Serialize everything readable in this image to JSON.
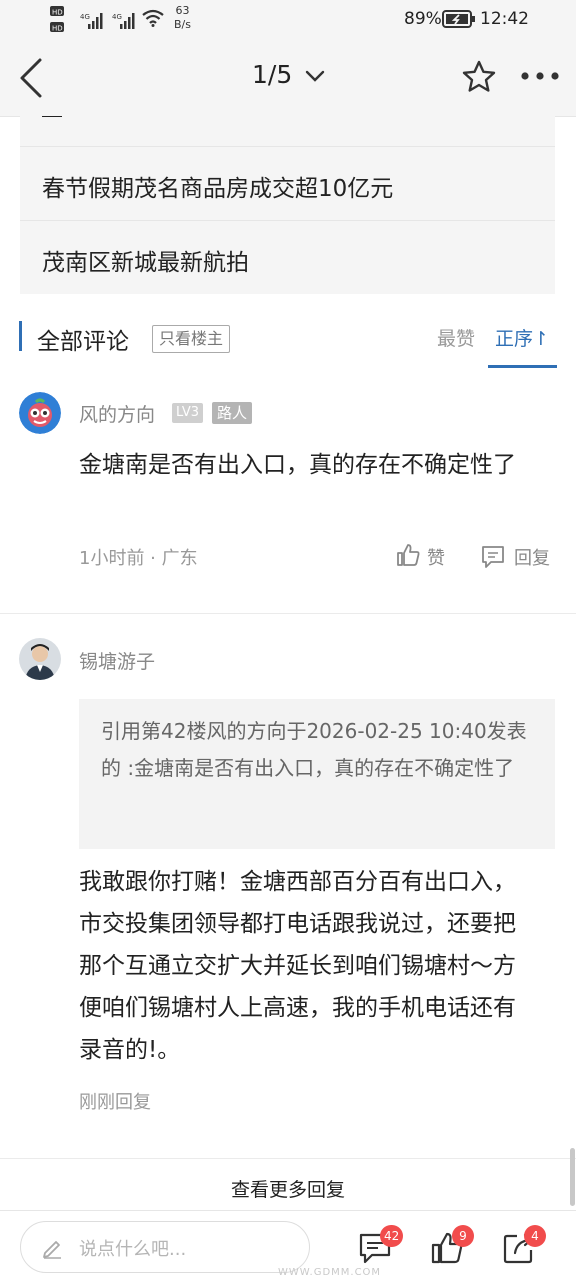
{
  "status_bar": {
    "net_speed_value": "63",
    "net_speed_unit": "B/s",
    "battery": "89%",
    "time": "12:42"
  },
  "nav": {
    "page_indicator": "1/5"
  },
  "related_articles": [
    {
      "title": "春节假期茂名商品房成交超10亿元"
    },
    {
      "title": "茂南区新城最新航拍"
    }
  ],
  "comments_header": {
    "title": "全部评论",
    "only_op_label": "只看楼主",
    "sort_hot": "最赞",
    "sort_order": "正序↾"
  },
  "comments": [
    {
      "username": "风的方向",
      "level": "LV3",
      "tag": "路人",
      "text": "金塘南是否有出入口，真的存在不确定性了",
      "meta": "1小时前 · 广东",
      "like_label": "赞",
      "reply_label": "回复"
    },
    {
      "username": "锡塘游子",
      "quote": "引用第42楼风的方向于2026-02-25 10:40发表的 :金塘南是否有出入口，真的存在不确定性了",
      "text": "我敢跟你打赌！金塘西部百分百有出口入，市交投集团领导都打电话跟我说过，还要把那个互通立交扩大并延长到咱们锡塘村～方便咱们锡塘村人上高速，我的手机电话还有录音的!。",
      "meta": "刚刚回复"
    }
  ],
  "more_replies": "查看更多回复",
  "bottom_bar": {
    "input_placeholder": "说点什么吧...",
    "comment_count": "42",
    "like_count": "9",
    "share_count": "4"
  },
  "watermark": "WWW.GDMM.COM",
  "colors": {
    "accent": "#2f6fb5",
    "badge": "#f14c4c"
  }
}
